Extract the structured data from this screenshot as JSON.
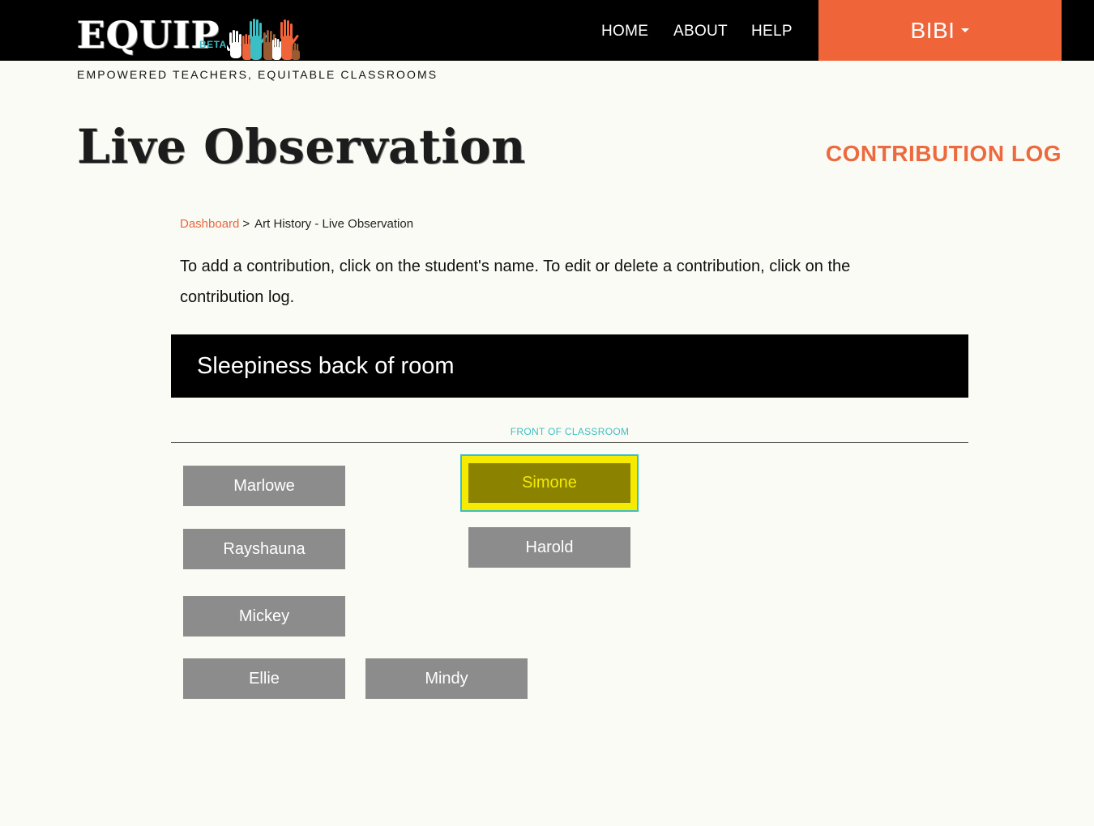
{
  "header": {
    "logo_text": "EQUIP",
    "logo_badge": "BETA",
    "nav": {
      "home": "HOME",
      "about": "ABOUT",
      "help": "HELP"
    },
    "user_menu_label": "BIBI",
    "tagline": "EMPOWERED TEACHERS, EQUITABLE CLASSROOMS",
    "colors": {
      "accent": "#f0643a",
      "teal": "#3bbfc4",
      "bar": "#000000"
    }
  },
  "page": {
    "title": "Live Observation",
    "contribution_log_link": "CONTRIBUTION LOG"
  },
  "breadcrumb": {
    "link": "Dashboard",
    "separator": ">",
    "current": "Art History - Live Observation"
  },
  "instructions": "To add a contribution, click on the student's name. To edit or delete a contribution, click on the contribution log.",
  "banner_text": "Sleepiness back of room",
  "seating": {
    "front_label": "FRONT OF CLASSROOM",
    "selected_student": "Simone",
    "students": {
      "marlowe": "Marlowe",
      "simone": "Simone",
      "rayshauna": "Rayshauna",
      "harold": "Harold",
      "mickey": "Mickey",
      "ellie": "Ellie",
      "mindy": "Mindy"
    }
  }
}
